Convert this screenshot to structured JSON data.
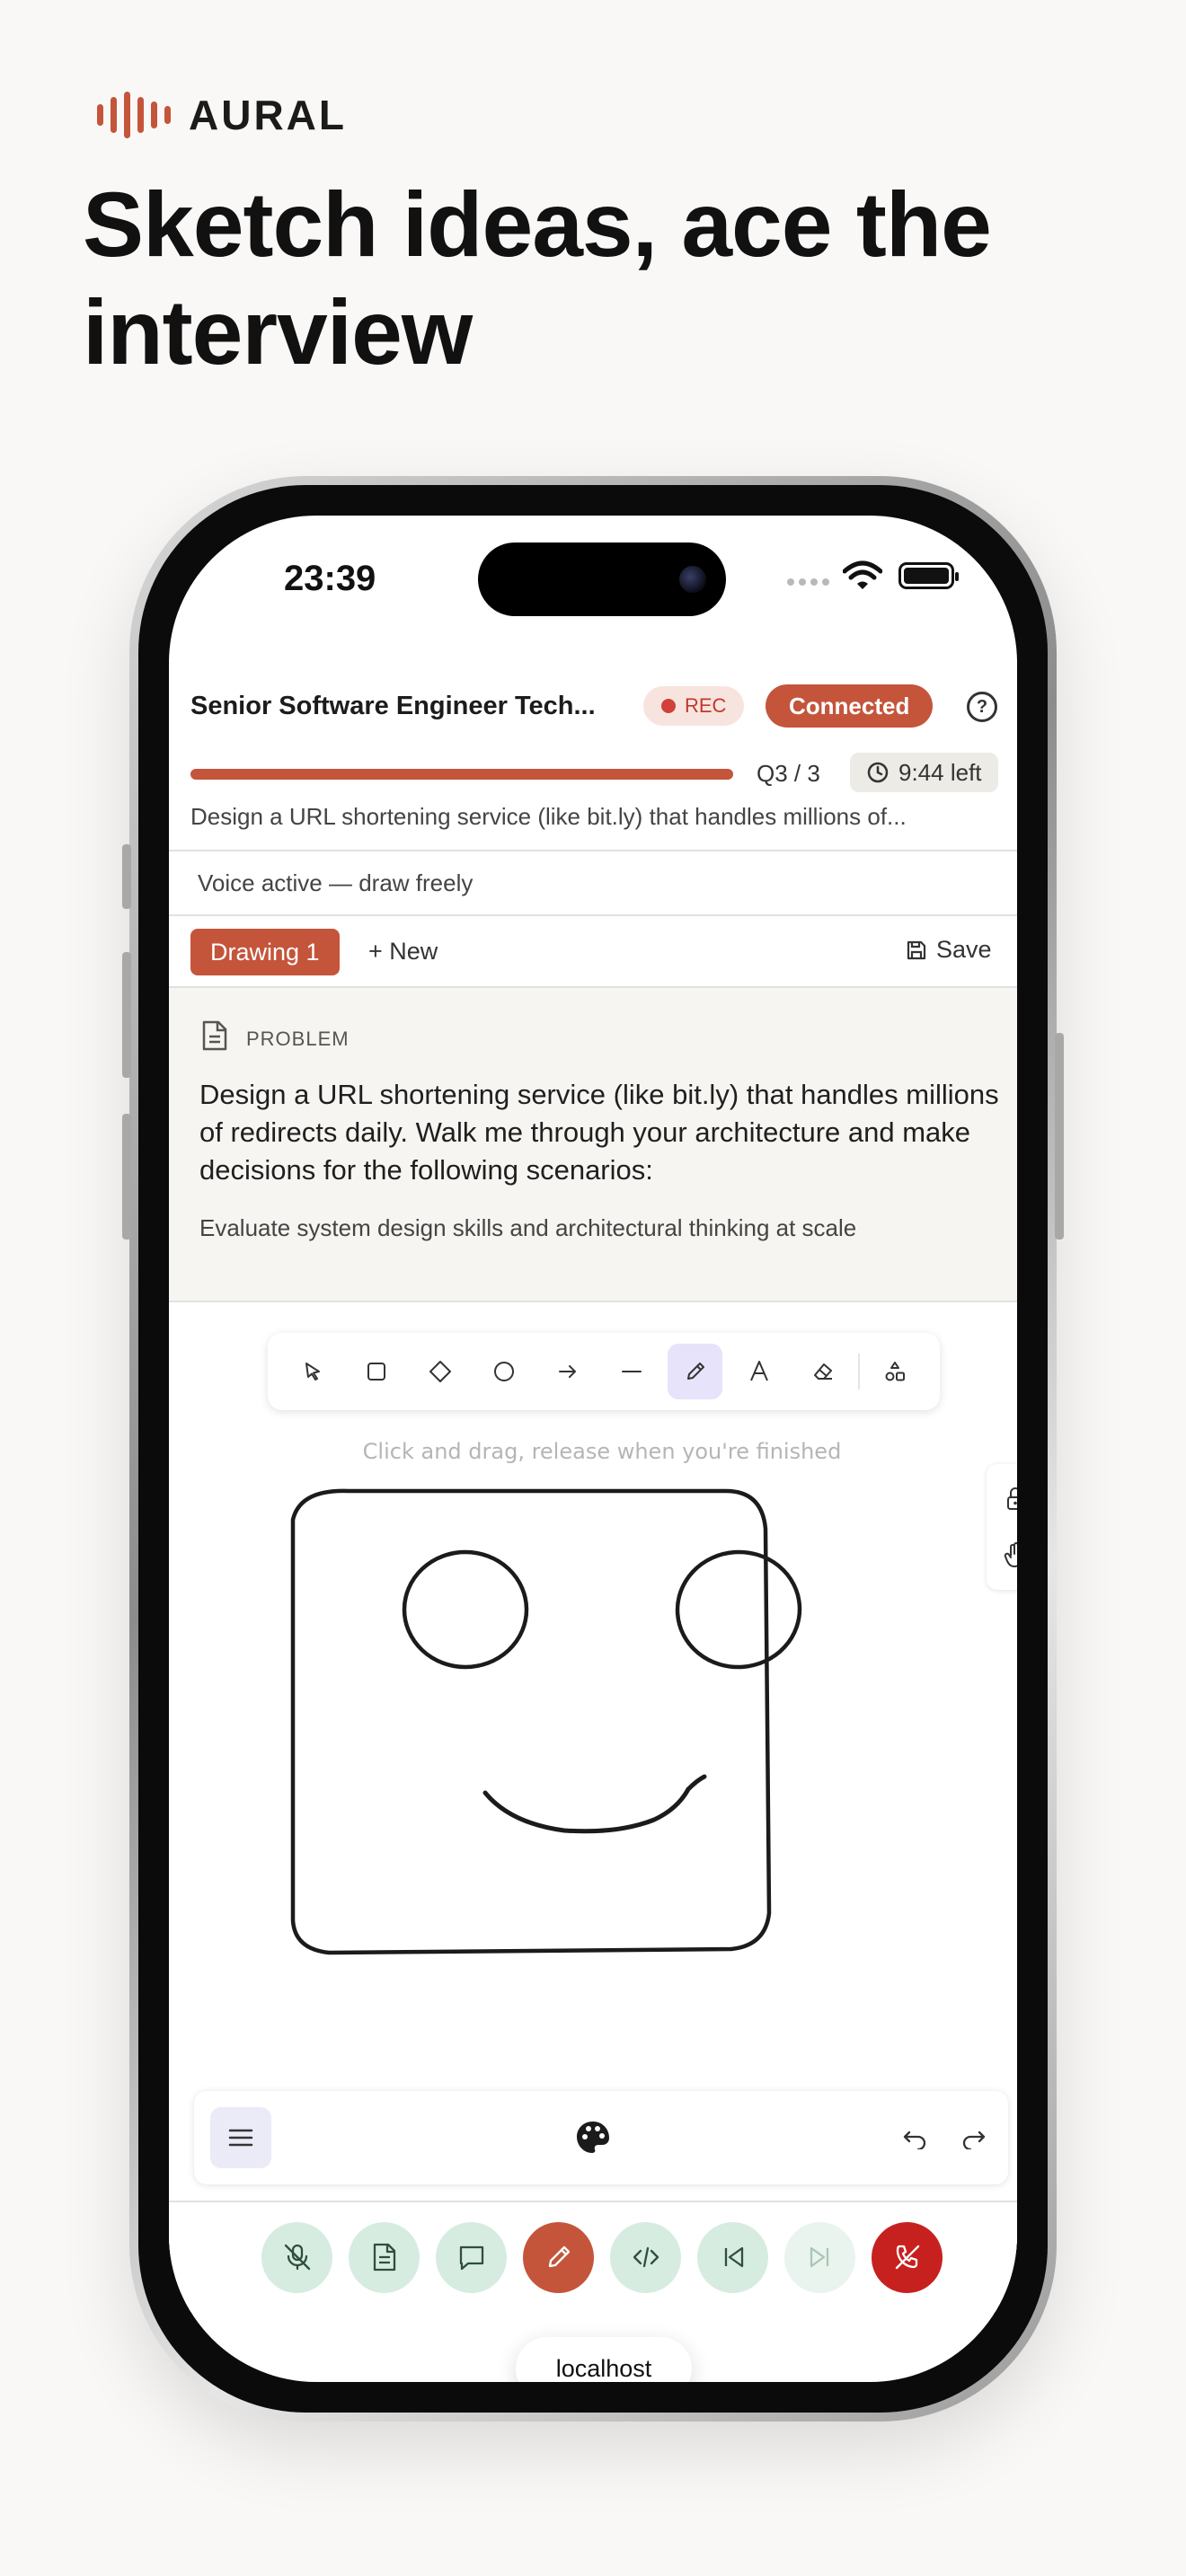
{
  "brand": {
    "name": "AURAL",
    "color": "#c4553b"
  },
  "hero": {
    "headline": "Sketch ideas, ace the interview"
  },
  "status_bar": {
    "time": "23:39"
  },
  "header": {
    "interview_title": "Senior Software Engineer Tech...",
    "rec_label": "REC",
    "connection_label": "Connected",
    "help_icon": "question-circle-icon",
    "progress_fraction": 1.0,
    "question_counter": "Q3 / 3",
    "time_left": "9:44 left",
    "problem_teaser": "Design a URL shortening service (like bit.ly) that handles millions of..."
  },
  "voice": {
    "status": "Voice active — draw freely"
  },
  "tabs": {
    "active_label": "Drawing 1",
    "new_label": "+ New",
    "save_label": "Save"
  },
  "problem": {
    "label": "PROBLEM",
    "text": "Design a URL shortening service (like bit.ly) that handles millions of redirects daily. Walk me through your architecture and make decisions for the following scenarios:",
    "subtitle": "Evaluate system design skills and architectural thinking at scale"
  },
  "canvas": {
    "hint": "Click and drag, release when you're finished",
    "tools": [
      "selection",
      "rectangle",
      "diamond",
      "ellipse",
      "arrow",
      "line",
      "draw",
      "text",
      "eraser",
      "more-shapes"
    ],
    "active_tool": "draw",
    "side_controls": [
      "lock-icon",
      "hand-icon"
    ]
  },
  "bottom_toolbar": {
    "icons": [
      "menu-icon",
      "palette-icon",
      "undo-icon",
      "redo-icon"
    ]
  },
  "call_controls": [
    "mic-off-icon",
    "notes-icon",
    "chat-icon",
    "pencil-icon",
    "code-icon",
    "previous-icon",
    "next-icon",
    "end-call-icon"
  ],
  "browser": {
    "url": "localhost"
  },
  "colors": {
    "accent": "#c4553b",
    "rec_red": "#c03a2b",
    "end_call": "#c7211f",
    "control_bg": "#d7ece0",
    "active_tool_bg": "#e6e3fb"
  }
}
